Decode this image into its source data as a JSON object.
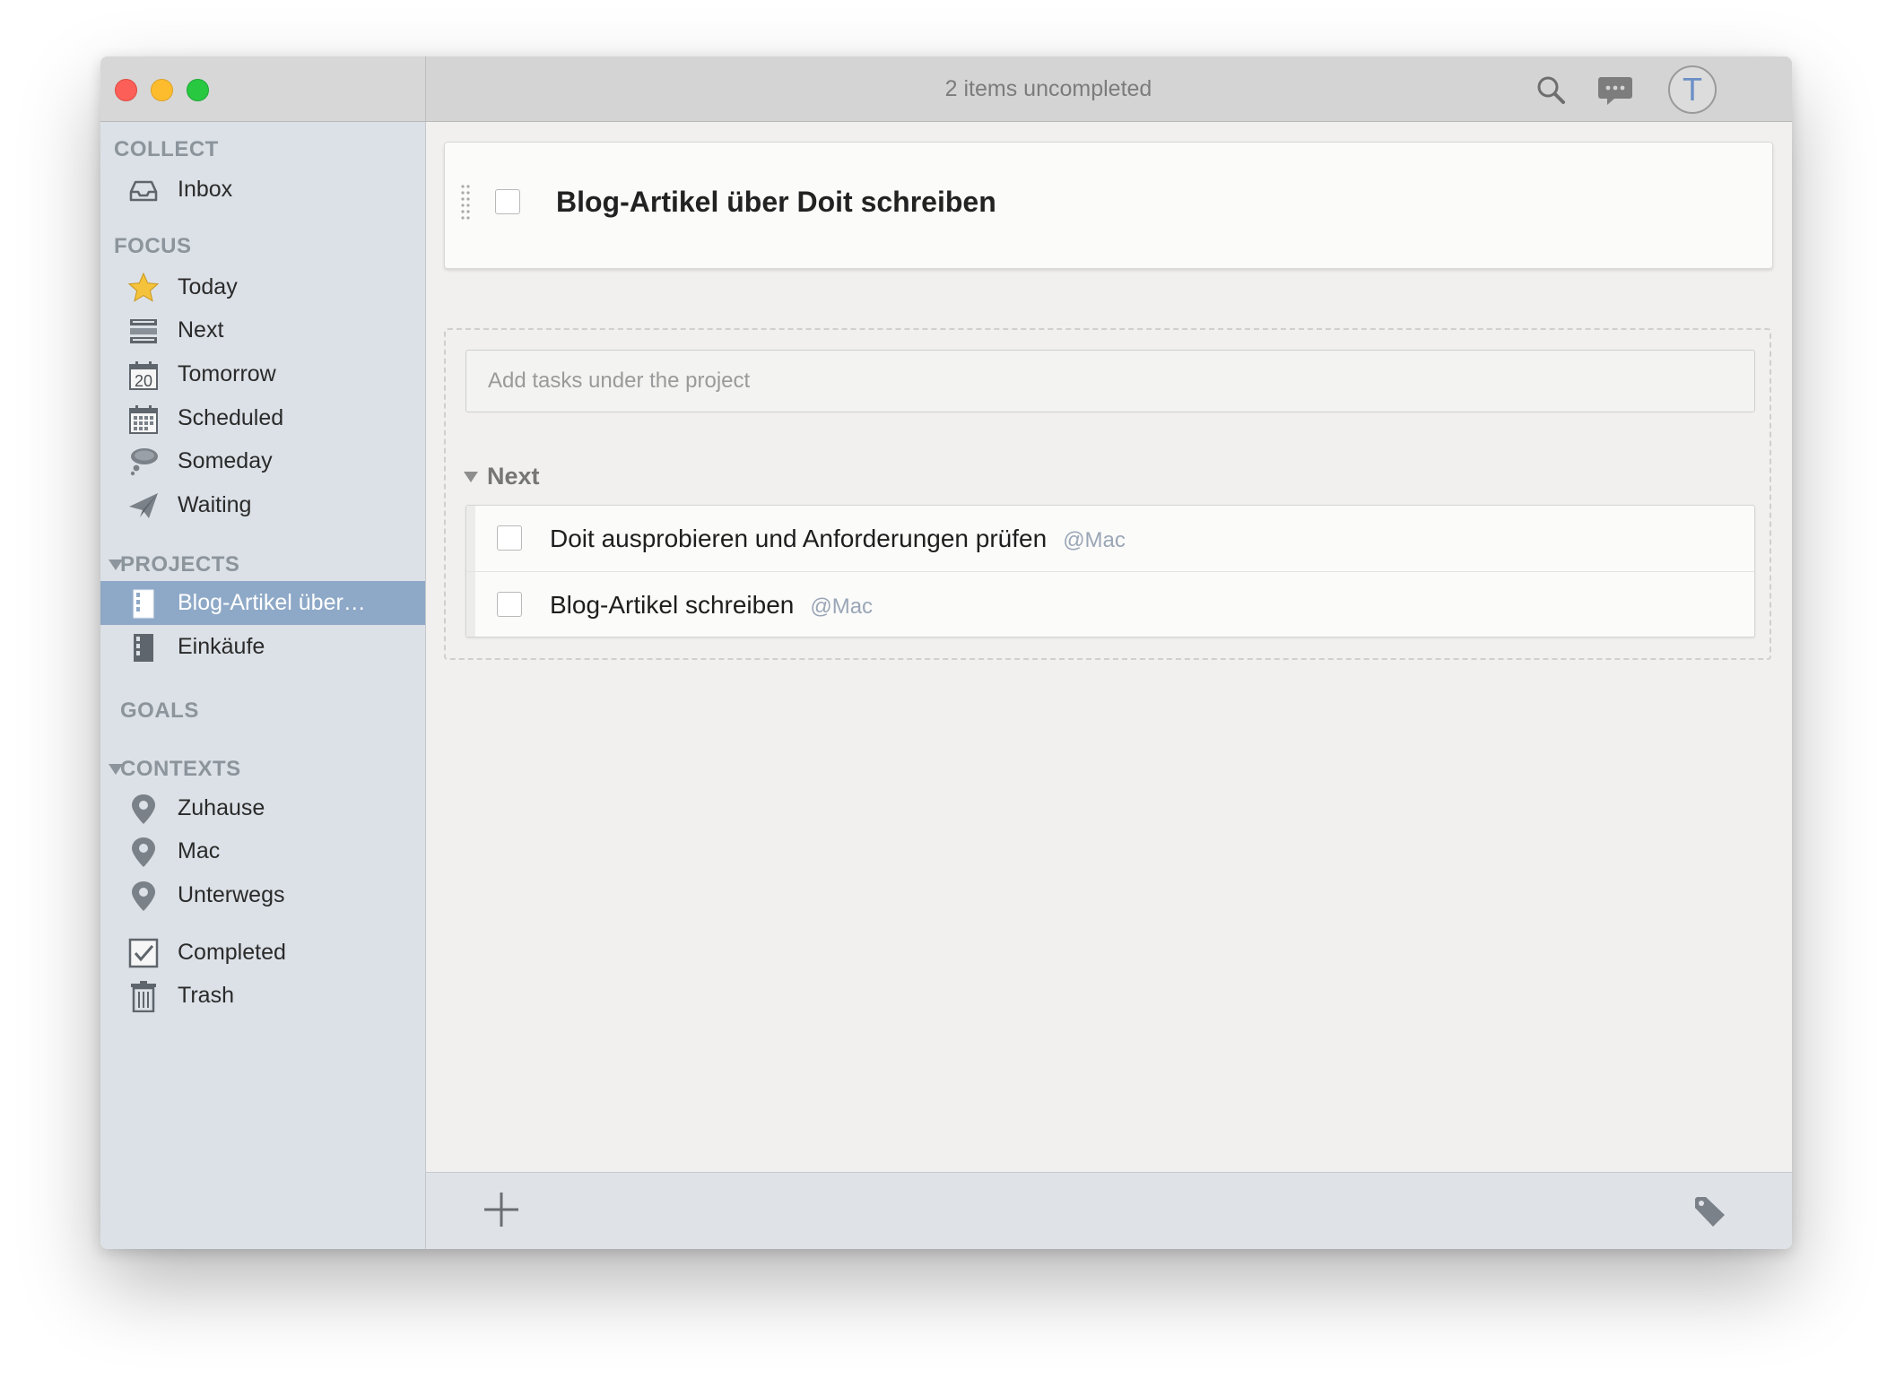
{
  "titlebar": {
    "title": "2 items uncompleted",
    "avatar_initial": "T"
  },
  "sidebar": {
    "collect_header": "COLLECT",
    "inbox": "Inbox",
    "focus_header": "FOCUS",
    "focus_items": [
      "Today",
      "Next",
      "Tomorrow",
      "Scheduled",
      "Someday",
      "Waiting"
    ],
    "tomorrow_day": "20",
    "projects_header": "PROJECTS",
    "projects": [
      "Blog-Artikel über…",
      "Einkäufe"
    ],
    "goals_header": "GOALS",
    "contexts_header": "CONTEXTS",
    "contexts": [
      "Zuhause",
      "Mac",
      "Unterwegs"
    ],
    "completed": "Completed",
    "trash": "Trash"
  },
  "project": {
    "title": "Blog-Artikel über Doit schreiben",
    "add_placeholder": "Add tasks under the project",
    "section_label": "Next",
    "tasks": [
      {
        "title": "Doit ausprobieren und Anforderungen prüfen",
        "context": "@Mac"
      },
      {
        "title": "Blog-Artikel schreiben",
        "context": "@Mac"
      }
    ]
  },
  "colors": {
    "sidebar_bg": "#dce1e7",
    "selected_bg": "#8ea9c7",
    "accent_blue": "#6b8fc7",
    "context_tag": "#9aa6b6"
  }
}
